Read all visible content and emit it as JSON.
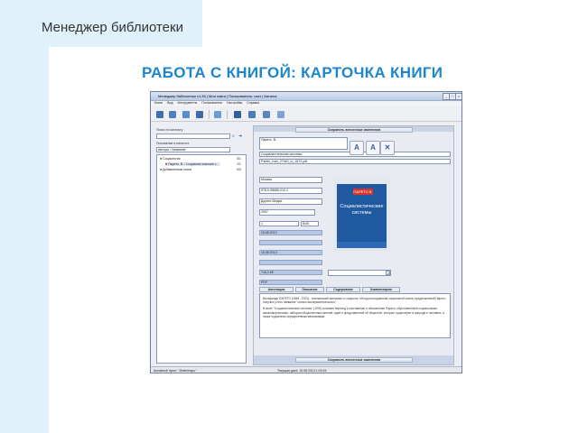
{
  "slide": {
    "title": "Менеджер библиотеки",
    "heading": "РАБОТА С КНИГОЙ: КАРТОЧКА КНИГИ"
  },
  "window": {
    "title": "Менеджер библиотеки v1.39 | Мои книги | Пользователь: user | Каталог",
    "buttons": [
      "_",
      "□",
      "×"
    ]
  },
  "menu": [
    "Книги",
    "Вид",
    "Инструменты",
    "Пользователи",
    "Настройки",
    "Справка"
  ],
  "toolbar_icons": [
    "open-book-icon",
    "book-icon",
    "print-icon",
    "users-icon",
    "sync-icon",
    "list-icon",
    "stack-icon",
    "save-icon",
    "search-icon"
  ],
  "left": {
    "search_label": "Поиск по каталогу",
    "search_value": "",
    "nav_label": "Положение в каталоге",
    "nav_value": "Авторы / Название",
    "tree": [
      {
        "label": "Социология",
        "count": "0/1",
        "level": 0
      },
      {
        "label": "Парето, В. / Социалистические с...",
        "count": "1/1",
        "level": 1,
        "selected": true
      },
      {
        "label": "Добавленные книги",
        "count": "0/0",
        "level": 0
      }
    ]
  },
  "right": {
    "save_top": "Сохранить внесенные изменения",
    "author": "Парето, В.",
    "title_field": "Социалистические системы",
    "file_field": "Pareto_Ivan_27440_to_1870.pdf",
    "city": "Москва",
    "isbn": "978-5-98685-019-1",
    "publisher": "Директ-Медиа",
    "year": "2007",
    "pages": "1",
    "pages_unit": "8/45",
    "date_added": "15.08.2013",
    "date_modified": "15.08.2013",
    "size": "716,2 Кб",
    "format": "PDF",
    "tabs": [
      "Аннотация",
      "Описание",
      "Содержание",
      "Комментарии"
    ],
    "description": [
      "Вильфредо ПАРЕТО (1848 - 1923) - итальянский экономист и социолог. Метод исследования социальной жизни, предложенный Парето, получил у него название \"логико-экспериментального\".",
      "В книге \"Социалистические системы\" (1902) изложен переход к постижению и объяснению Парето, обусловленный социальными закономерностями, набором общественных мнений, идей и представлений об обществе, которые существуют в природе и человеке, а также подчинены определенным механизмам."
    ],
    "save_bottom": "Сохранить внесенные изменения"
  },
  "cover": {
    "badge": "ПАРЕТО В.",
    "title": "Социалистические системы"
  },
  "status": {
    "left": "Активный пункт: \"Инвентарь\"",
    "right": "Текущая дата: 15.08.2013   1:09:15"
  }
}
